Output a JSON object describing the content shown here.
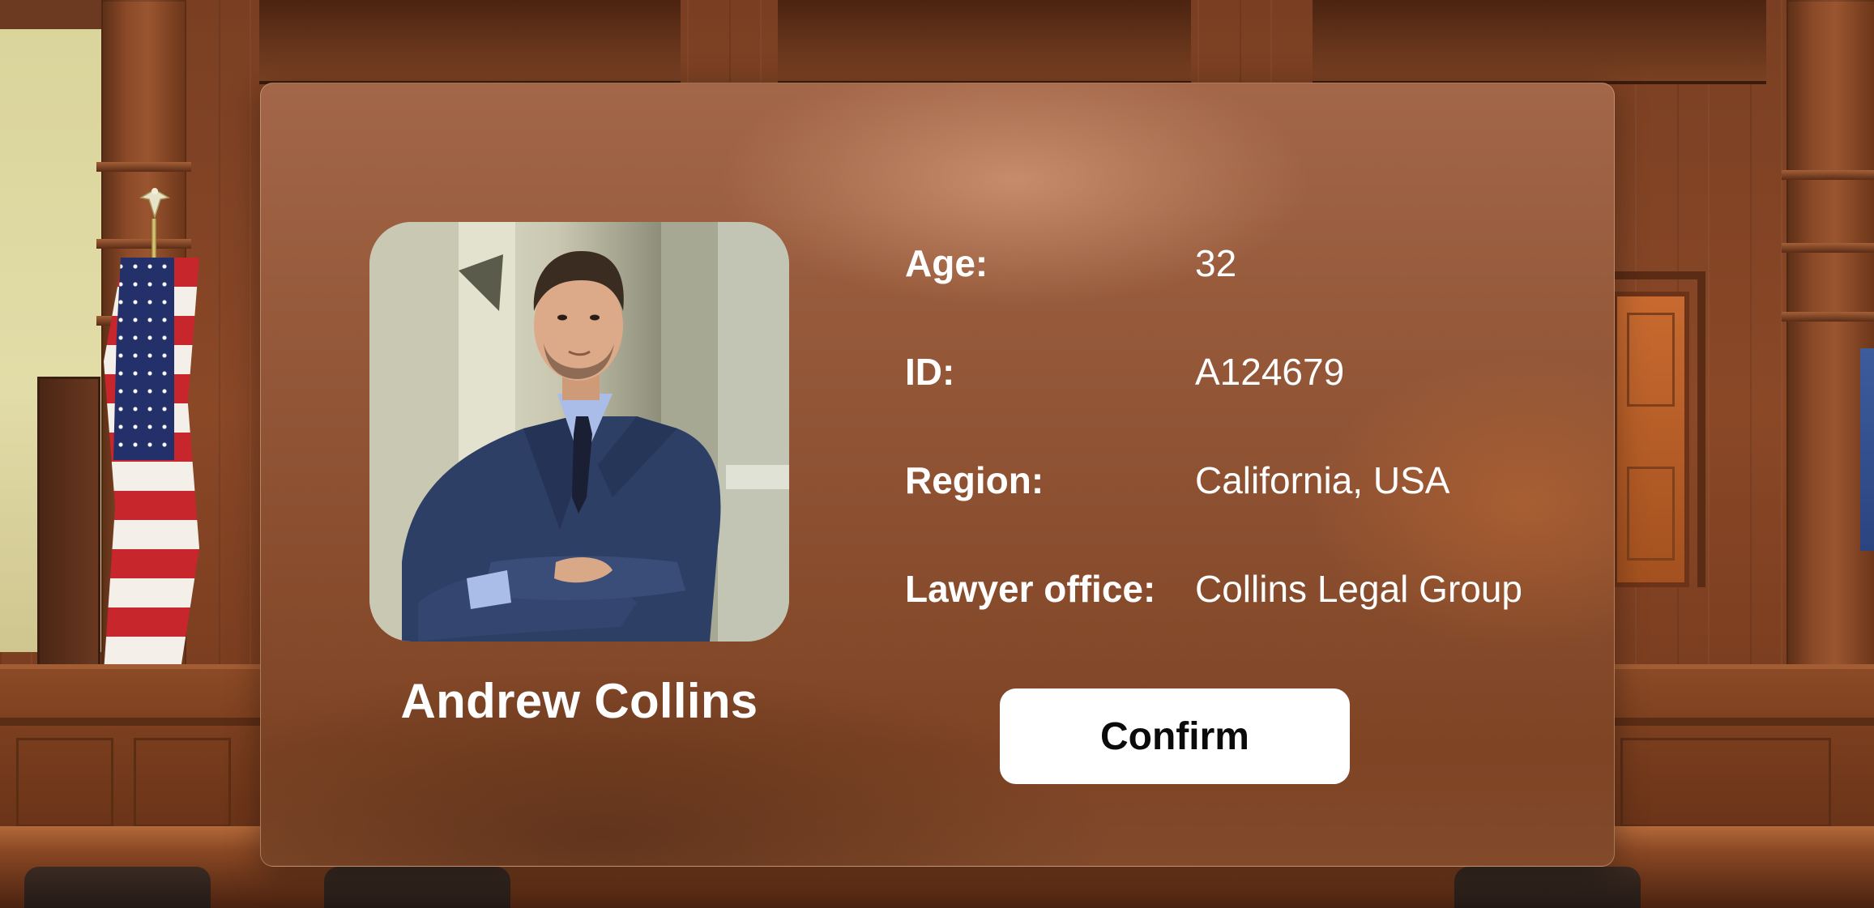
{
  "profile": {
    "name": "Andrew Collins",
    "photo_alt": "Andrew Collins"
  },
  "details": [
    {
      "label": "Age:",
      "value": "32"
    },
    {
      "label": "ID:",
      "value": "A124679"
    },
    {
      "label": "Region:",
      "value": "California, USA"
    },
    {
      "label": "Lawyer office:",
      "value": "Collins Legal Group"
    }
  ],
  "actions": {
    "confirm_label": "Confirm"
  },
  "colors": {
    "card": "#8f5434",
    "button_bg": "#ffffff",
    "button_text": "#0b0b0b",
    "text": "#ffffff"
  },
  "icons": {
    "photo": "profile-photo"
  }
}
